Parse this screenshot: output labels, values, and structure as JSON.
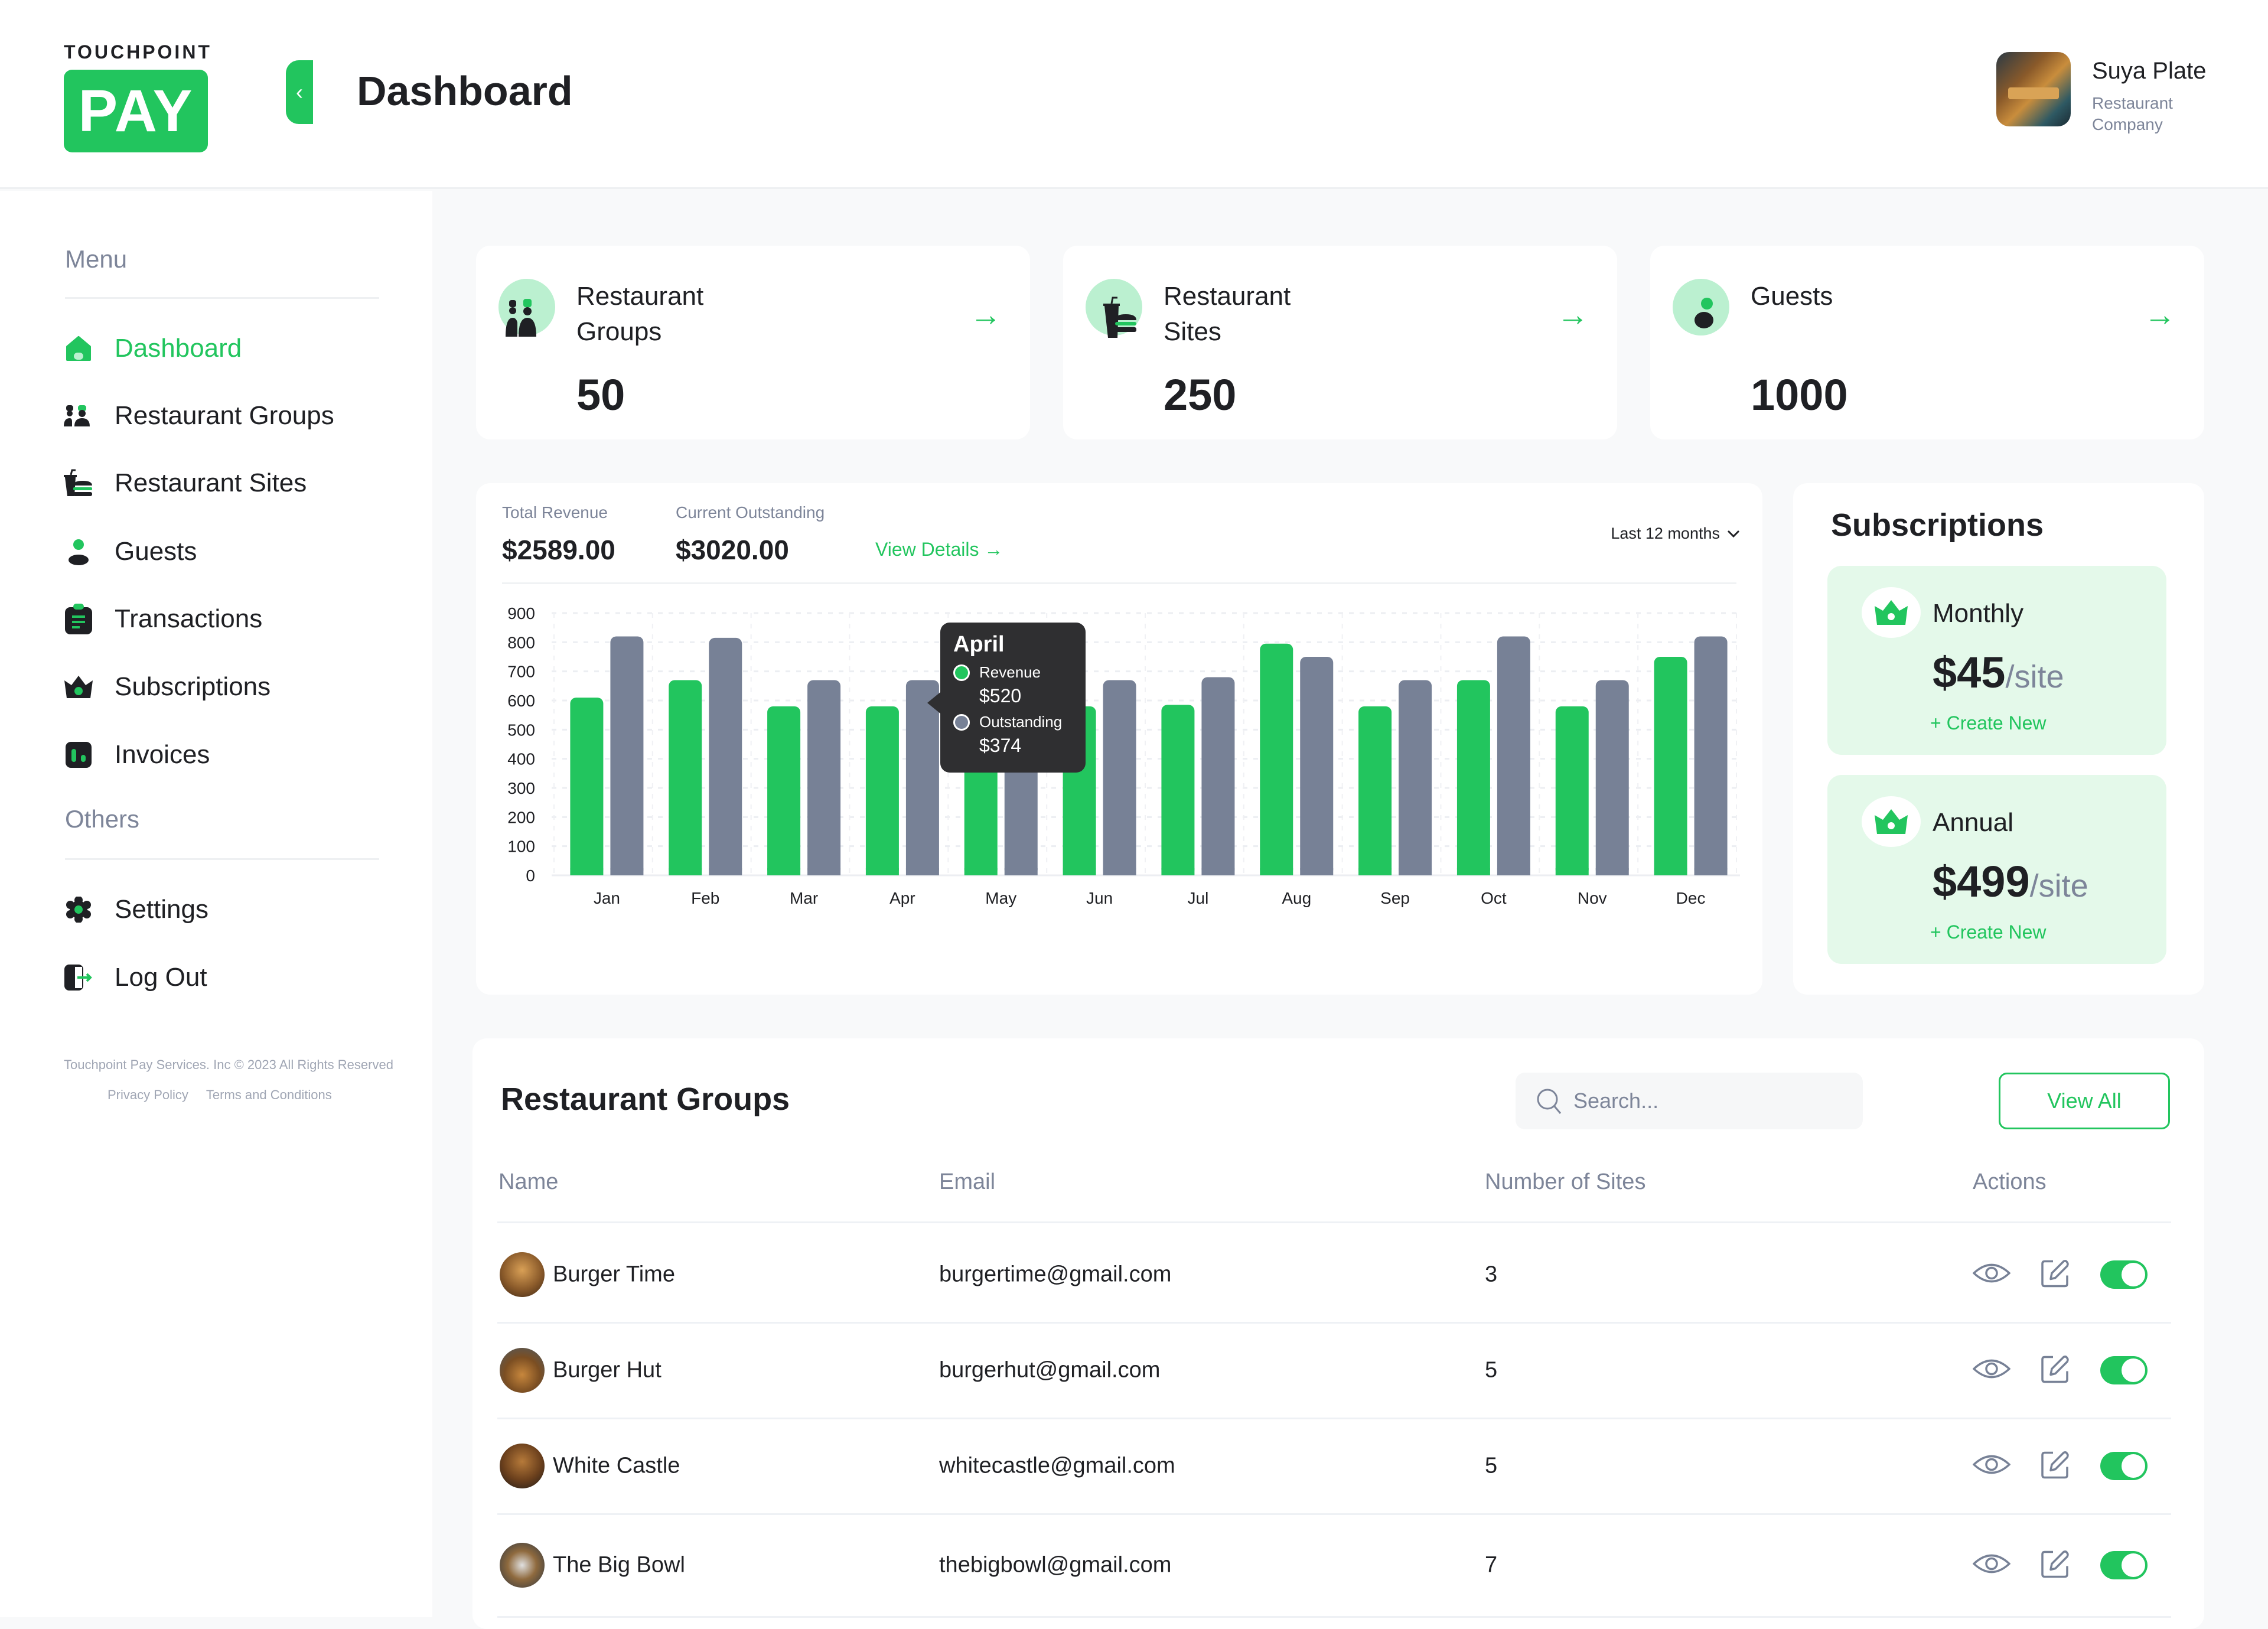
{
  "brand": {
    "top_text": "TOUCHPOINT",
    "box_text": "PAY",
    "accent": "#22c55e"
  },
  "header": {
    "title": "Dashboard",
    "collapse_icon": "chevron-left-icon"
  },
  "profile": {
    "name": "Suya Plate",
    "subtitle": "Restaurant Company"
  },
  "sidebar": {
    "menu_label": "Menu",
    "items": [
      {
        "label": "Dashboard",
        "icon": "home-icon",
        "active": true
      },
      {
        "label": "Restaurant Groups",
        "icon": "chefs-icon"
      },
      {
        "label": "Restaurant Sites",
        "icon": "fastfood-icon"
      },
      {
        "label": "Guests",
        "icon": "user-icon"
      },
      {
        "label": "Transactions",
        "icon": "clipboard-icon"
      },
      {
        "label": "Subscriptions",
        "icon": "crown-icon"
      },
      {
        "label": "Invoices",
        "icon": "invoice-icon"
      }
    ],
    "others_label": "Others",
    "others": [
      {
        "label": "Settings",
        "icon": "gear-icon"
      },
      {
        "label": "Log Out",
        "icon": "logout-icon"
      }
    ],
    "footer": {
      "copyright": "Touchpoint Pay Services. Inc © 2023 All Rights Reserved",
      "privacy": "Privacy Policy",
      "terms": "Terms  and Conditions"
    }
  },
  "stats": [
    {
      "title": "Restaurant Groups",
      "value": "50",
      "icon": "chefs-icon"
    },
    {
      "title": "Restaurant Sites",
      "value": "250",
      "icon": "fastfood-icon"
    },
    {
      "title": "Guests",
      "value": "1000",
      "icon": "user-icon"
    }
  ],
  "revenue": {
    "total_label": "Total Revenue",
    "total_value": "$2589.00",
    "outstanding_label": "Current Outstanding",
    "outstanding_value": "$3020.00",
    "view_details": "View Details →",
    "range": "Last 12 months"
  },
  "tooltip": {
    "title": "April",
    "revenue_label": "Revenue",
    "revenue_value": "$520",
    "outstanding_label": "Outstanding",
    "outstanding_value": "$374"
  },
  "chart_data": {
    "type": "bar",
    "title": "",
    "xlabel": "",
    "ylabel": "",
    "categories": [
      "Jan",
      "Feb",
      "Mar",
      "Apr",
      "May",
      "Jun",
      "Jul",
      "Aug",
      "Sep",
      "Oct",
      "Nov",
      "Dec"
    ],
    "series": [
      {
        "name": "Revenue",
        "color": "#22c55e",
        "values": [
          610,
          670,
          580,
          580,
          490,
          580,
          585,
          795,
          580,
          670,
          580,
          750
        ]
      },
      {
        "name": "Outstanding",
        "color": "#778196",
        "values": [
          820,
          815,
          670,
          670,
          605,
          670,
          680,
          750,
          670,
          820,
          670,
          820
        ]
      }
    ],
    "ylim": [
      0,
      900
    ],
    "yticks": [
      0,
      100,
      200,
      300,
      400,
      500,
      600,
      700,
      800,
      900
    ],
    "grid": true,
    "legend": "none"
  },
  "subscriptions": {
    "title": "Subscriptions",
    "plans": [
      {
        "name": "Monthly",
        "price": "$45",
        "unit": "/site",
        "action": "+ Create New"
      },
      {
        "name": "Annual",
        "price": "$499",
        "unit": "/site",
        "action": "+ Create New"
      }
    ]
  },
  "groups_table": {
    "title": "Restaurant Groups",
    "search_placeholder": "Search...",
    "view_all": "View All",
    "columns": [
      "Name",
      "Email",
      "Number of Sites",
      "Actions"
    ],
    "rows": [
      {
        "name": "Burger Time",
        "email": "burgertime@gmail.com",
        "sites": "3",
        "enabled": true
      },
      {
        "name": "Burger Hut",
        "email": "burgerhut@gmail.com",
        "sites": "5",
        "enabled": true
      },
      {
        "name": "White Castle",
        "email": "whitecastle@gmail.com",
        "sites": "5",
        "enabled": true
      },
      {
        "name": "The Big Bowl",
        "email": "thebigbowl@gmail.com",
        "sites": "7",
        "enabled": true
      }
    ]
  }
}
